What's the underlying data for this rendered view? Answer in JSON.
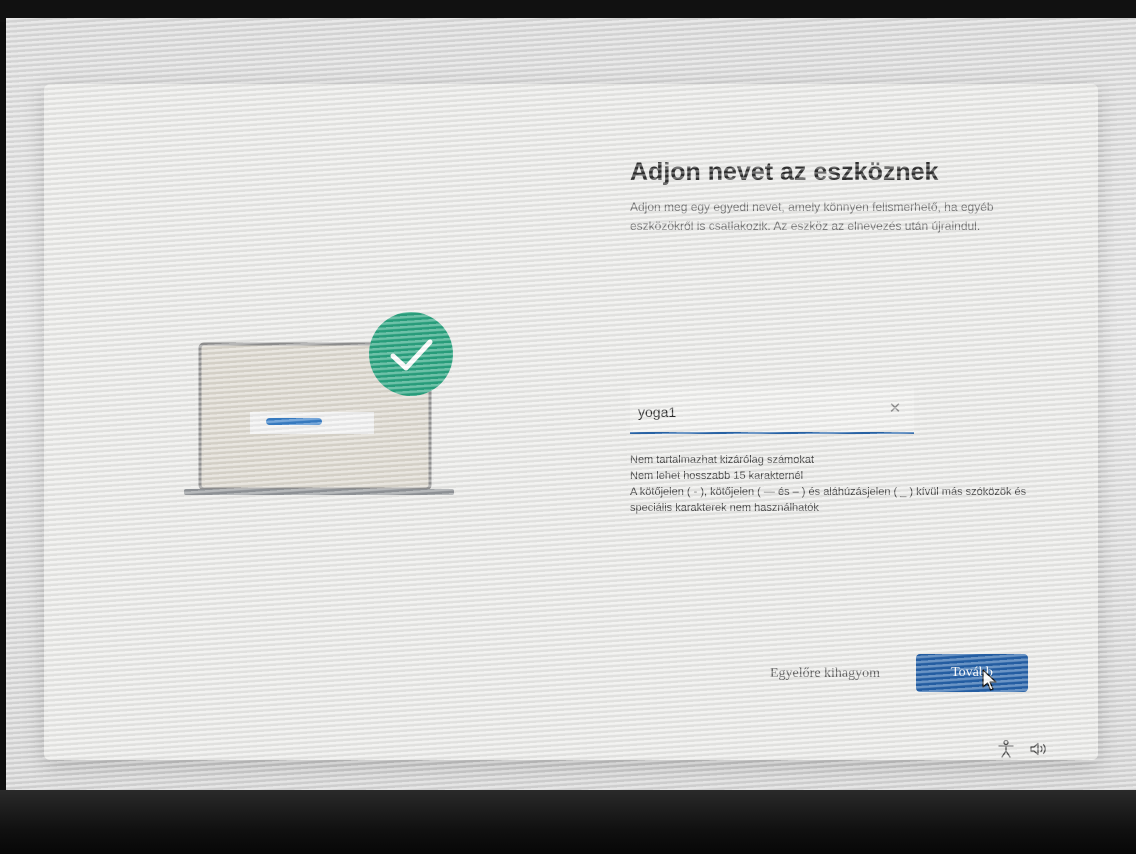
{
  "dialog": {
    "title": "Adjon nevet az eszköznek",
    "description": "Adjon meg egy egyedi nevet, amely könnyen felismerhető, ha egyéb eszközökről is csatlakozik. Az eszköz az elnevezés után újraindul."
  },
  "name_input": {
    "value": "yoga1",
    "clear_icon": "close-icon"
  },
  "rules": [
    "Nem tartalmazhat kizárólag számokat",
    "Nem lehet hosszabb 15 karakternél",
    "A kötőjelen ( - ), kötőjelen ( — és – ) és aláhúzásjelen ( _ ) kívül más szóközök és speciális karakterek nem használhatók"
  ],
  "buttons": {
    "skip": "Egyelőre kihagyom",
    "next": "Tovább"
  },
  "colors": {
    "accent": "#1a5aa6",
    "success": "#1fa07a"
  },
  "tray": {
    "icons": [
      "accessibility-icon",
      "volume-icon"
    ]
  }
}
